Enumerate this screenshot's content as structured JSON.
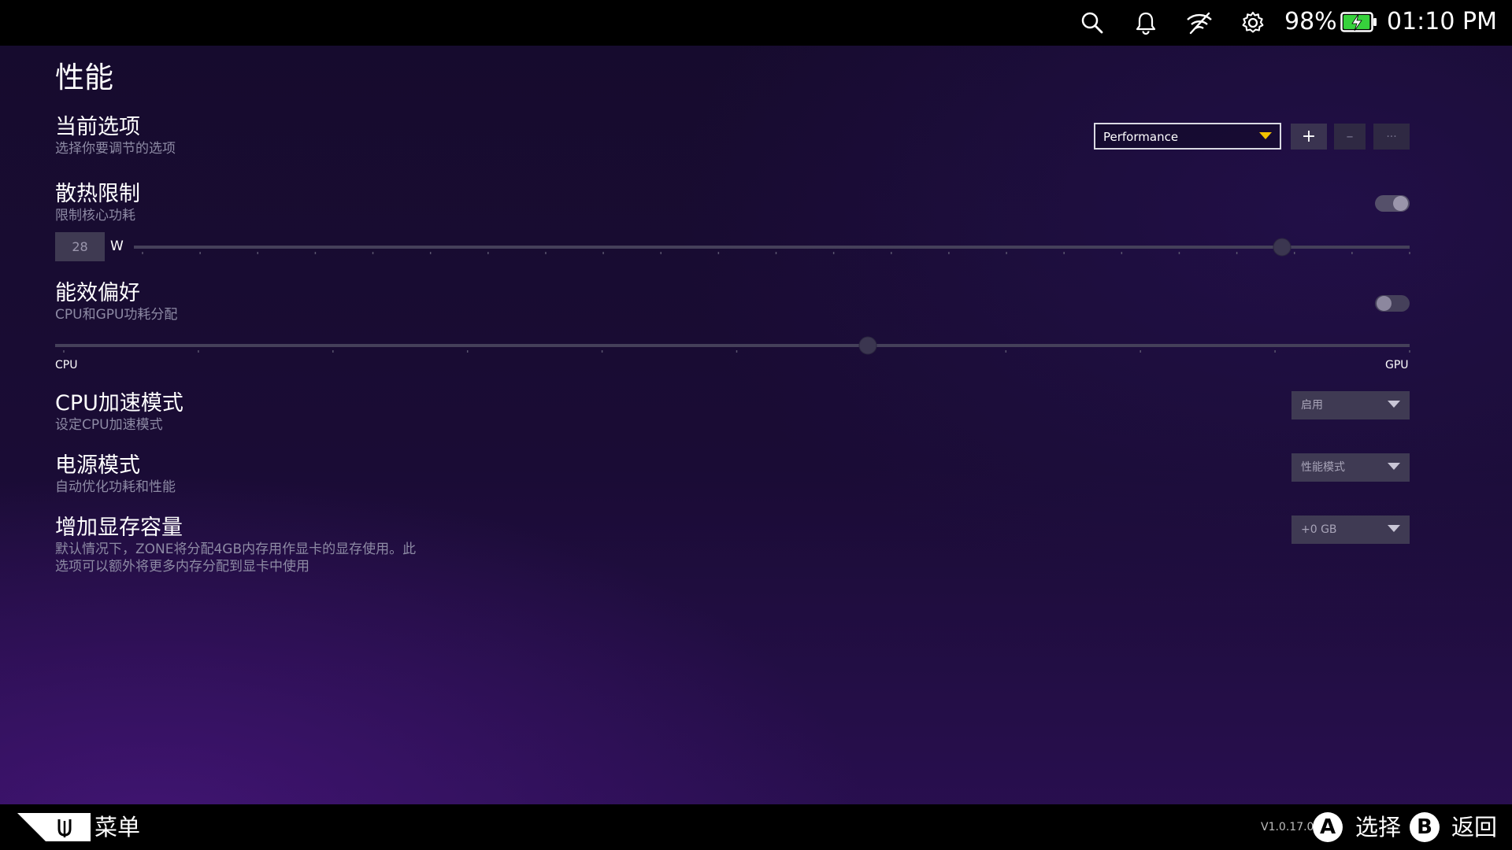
{
  "status_bar": {
    "battery_percent": "98%",
    "battery_level": 0.98,
    "time": "01:10 PM",
    "icons": [
      "search-icon",
      "bell-icon",
      "wifi-off-icon",
      "gear-icon",
      "battery-charging-icon"
    ],
    "battery_color": "#37d23c"
  },
  "page": {
    "title": "性能"
  },
  "current_profile": {
    "title": "当前选项",
    "subtitle": "选择你要调节的选项",
    "selected": "Performance",
    "add_label": "+",
    "remove_label": "–",
    "more_label": "···"
  },
  "thermal_limit": {
    "title": "散热限制",
    "subtitle": "限制核心功耗",
    "enabled": true,
    "value": "28",
    "unit": "W",
    "slider_fraction": 0.9
  },
  "efficiency": {
    "title": "能效偏好",
    "subtitle": "CPU和GPU功耗分配",
    "enabled": false,
    "left_label": "CPU",
    "right_label": "GPU",
    "slider_fraction": 0.6
  },
  "cpu_boost": {
    "title": "CPU加速模式",
    "subtitle": "设定CPU加速模式",
    "value": "启用"
  },
  "power_mode": {
    "title": "电源模式",
    "subtitle": "自动优化功耗和性能",
    "value": "性能模式"
  },
  "vram": {
    "title": "增加显存容量",
    "subtitle_line1": "默认情况下，ZONE将分配4GB内存用作显卡的显存使用。此",
    "subtitle_line2": "选项可以额外将更多内存分配到显卡中使用",
    "value": "+0 GB"
  },
  "bottom_bar": {
    "menu_label": "菜单",
    "version": "V1.0.17.0",
    "a_button": "A",
    "a_label": "选择",
    "b_button": "B",
    "b_label": "返回"
  },
  "colors": {
    "accent_caret": "#f2c200",
    "background": "#1a0c35"
  }
}
